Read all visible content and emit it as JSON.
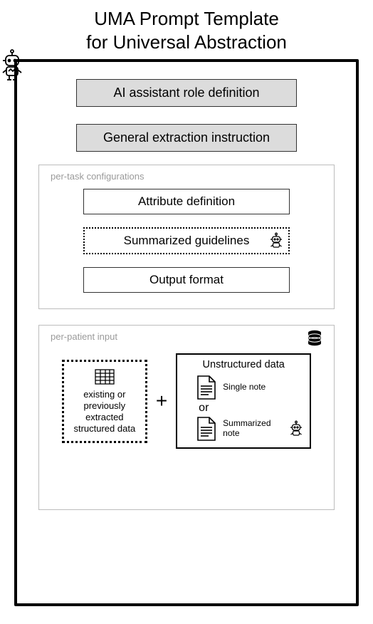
{
  "title_line1": "UMA Prompt Template",
  "title_line2": "for Universal Abstraction",
  "bars": {
    "role_def": "AI assistant role definition",
    "extraction_instr": "General extraction instruction"
  },
  "per_task": {
    "label": "per-task configurations",
    "attribute_def": "Attribute definition",
    "summarized_guidelines": "Summarized guidelines",
    "output_format": "Output format"
  },
  "per_patient": {
    "label": "per-patient input",
    "structured_text": "existing or previously extracted structured data",
    "plus": "+",
    "unstructured_title": "Unstructured data",
    "single_note": "Single note",
    "or": "or",
    "summarized_note": "Summarized note"
  }
}
